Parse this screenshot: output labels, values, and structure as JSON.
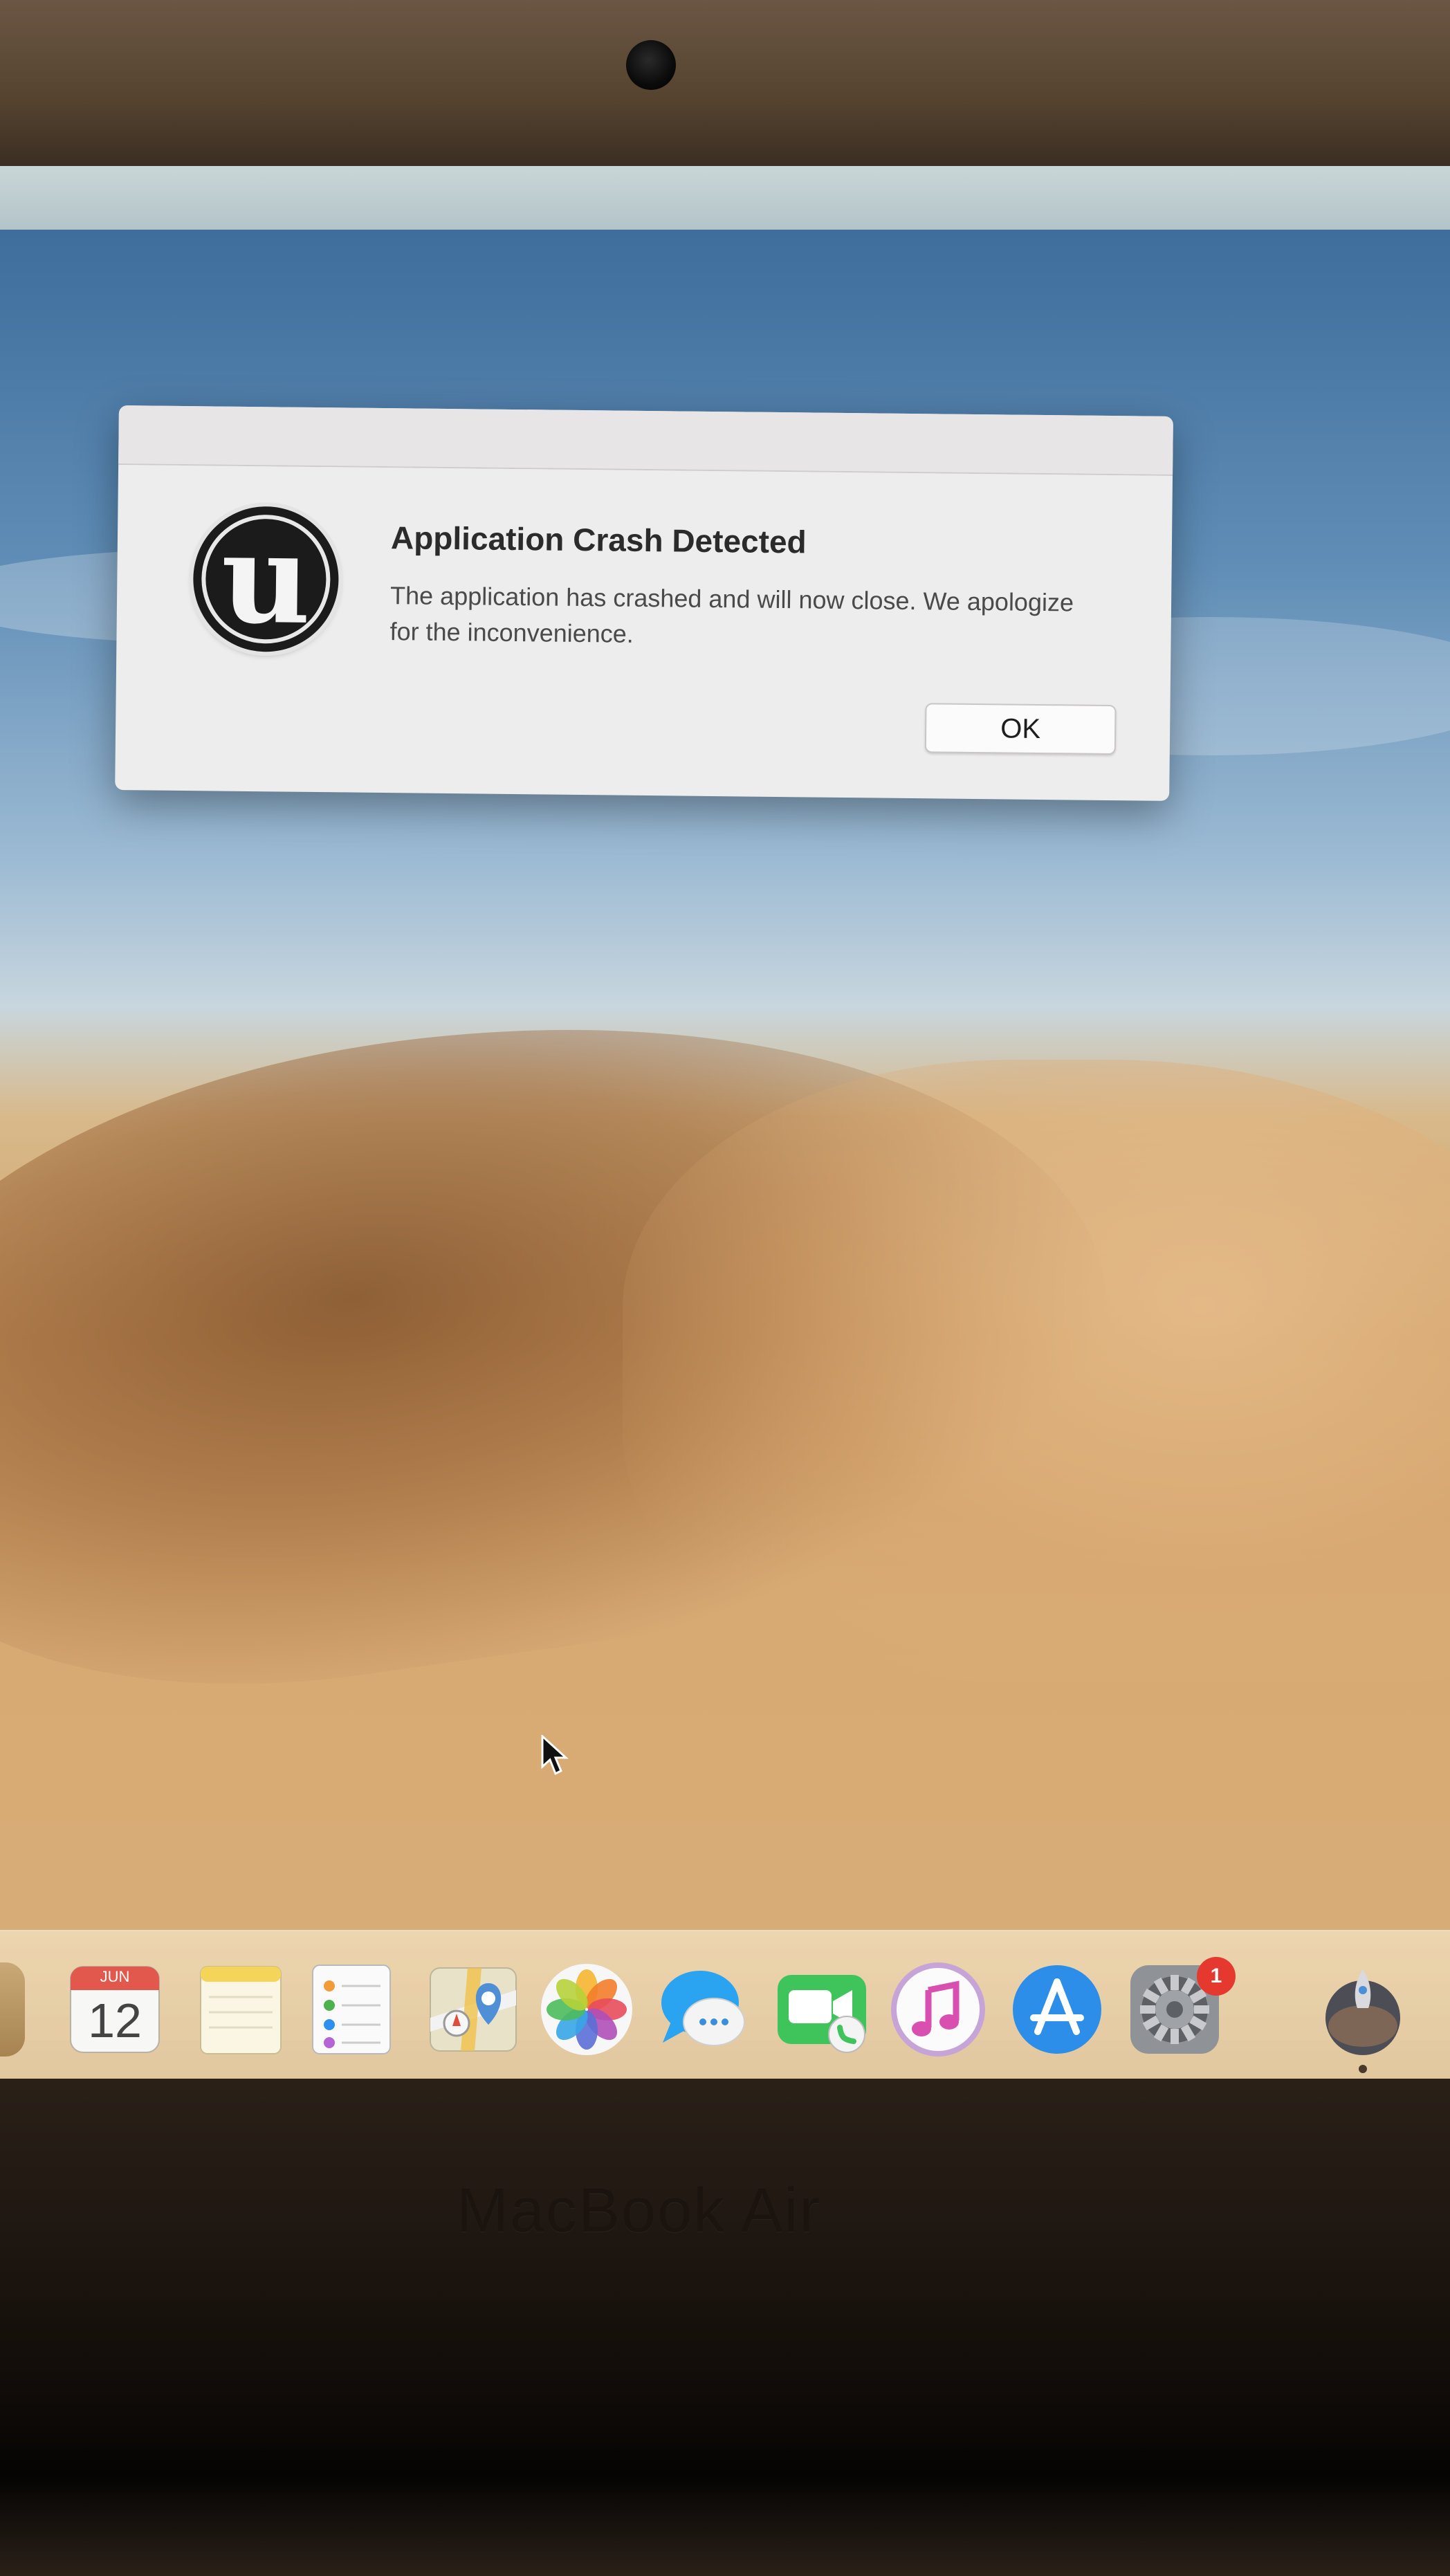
{
  "dialog": {
    "title": "Application Crash Detected",
    "message": "The application has crashed and will now close. We apologize for the inconvenience.",
    "ok_label": "OK",
    "icon_glyph": "u"
  },
  "dock": {
    "items": [
      {
        "name": "calendar",
        "icon": "calendar-icon",
        "month": "JUN",
        "day": "12"
      },
      {
        "name": "notes",
        "icon": "notes-icon"
      },
      {
        "name": "reminders",
        "icon": "reminders-icon"
      },
      {
        "name": "maps",
        "icon": "maps-icon"
      },
      {
        "name": "photos",
        "icon": "photos-icon"
      },
      {
        "name": "messages",
        "icon": "messages-icon"
      },
      {
        "name": "facetime",
        "icon": "facetime-icon"
      },
      {
        "name": "itunes",
        "icon": "itunes-icon"
      },
      {
        "name": "app-store",
        "icon": "app-store-icon"
      },
      {
        "name": "system-preferences",
        "icon": "system-preferences-icon",
        "badge": "1"
      },
      {
        "name": "launchpad",
        "icon": "rocket-icon"
      }
    ]
  },
  "hardware": {
    "label": "MacBook Air"
  },
  "colors": {
    "dialog_bg": "#eeeded",
    "badge_red": "#e5382e",
    "sky_blue": "#5f8db6",
    "sand": "#d7aa74"
  }
}
